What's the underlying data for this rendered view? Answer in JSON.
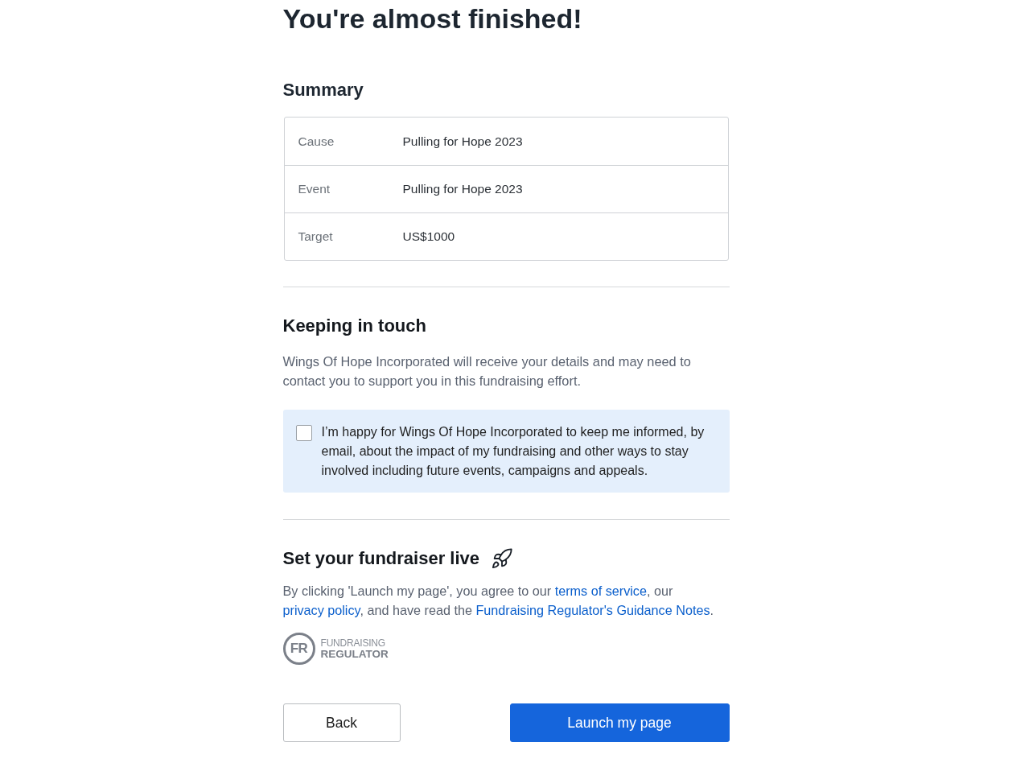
{
  "page": {
    "title": "You're almost finished!"
  },
  "summary": {
    "heading": "Summary",
    "rows": [
      {
        "label": "Cause",
        "value": "Pulling for Hope 2023"
      },
      {
        "label": "Event",
        "value": "Pulling for Hope 2023"
      },
      {
        "label": "Target",
        "value": "US$1000"
      }
    ]
  },
  "keeping_in_touch": {
    "heading": "Keeping in touch",
    "description": "Wings Of Hope Incorporated will receive your details and may need to contact you to support you in this fundraising effort.",
    "consent": {
      "checked": false,
      "label": "I’m happy for Wings Of Hope Incorporated to keep me informed, by email, about the impact of my fundraising and other ways to stay involved including future events, campaigns and appeals."
    }
  },
  "launch": {
    "heading": "Set your fundraiser live",
    "legal_text": [
      {
        "kind": "text",
        "text": "By clicking 'Launch my page', you agree to our "
      },
      {
        "kind": "link",
        "text": "terms of service"
      },
      {
        "kind": "text",
        "text": ", our "
      },
      {
        "kind": "link",
        "text": "privacy policy"
      },
      {
        "kind": "text",
        "text": ", and have read the "
      },
      {
        "kind": "link",
        "text": "Fundraising Regulator's Guidance Notes"
      },
      {
        "kind": "text",
        "text": "."
      }
    ]
  },
  "logo": {
    "mark": "FR",
    "line_1": "FUNDRAISING",
    "line_2": "REGULATOR"
  },
  "buttons": [
    {
      "kind": "secondary",
      "label": "Back"
    },
    {
      "kind": "primary",
      "label": "Launch my page"
    }
  ]
}
